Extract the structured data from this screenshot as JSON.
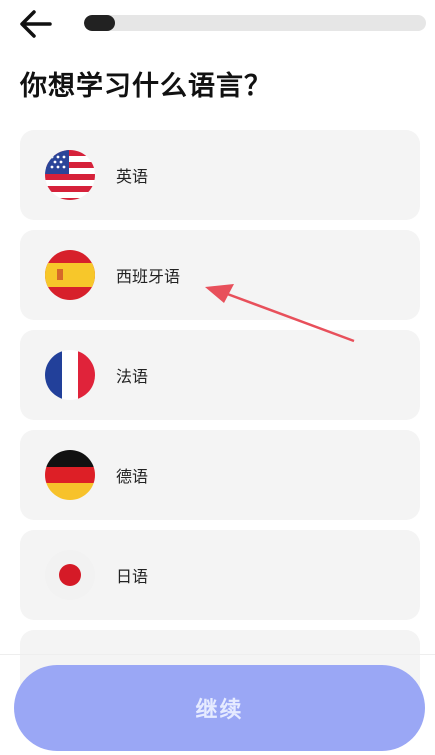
{
  "header": {
    "progress_fraction": 0.09
  },
  "page": {
    "title": "你想学习什么语言？"
  },
  "languages": [
    {
      "label": "英语",
      "flag": "us-flag-icon"
    },
    {
      "label": "西班牙语",
      "flag": "spain-flag-icon"
    },
    {
      "label": "法语",
      "flag": "france-flag-icon"
    },
    {
      "label": "德语",
      "flag": "germany-flag-icon"
    },
    {
      "label": "日语",
      "flag": "japan-flag-icon"
    }
  ],
  "footer": {
    "continue_label": "继续"
  },
  "colors": {
    "accent_button": "#9aa7f5",
    "annotation_arrow": "#e8505b"
  }
}
